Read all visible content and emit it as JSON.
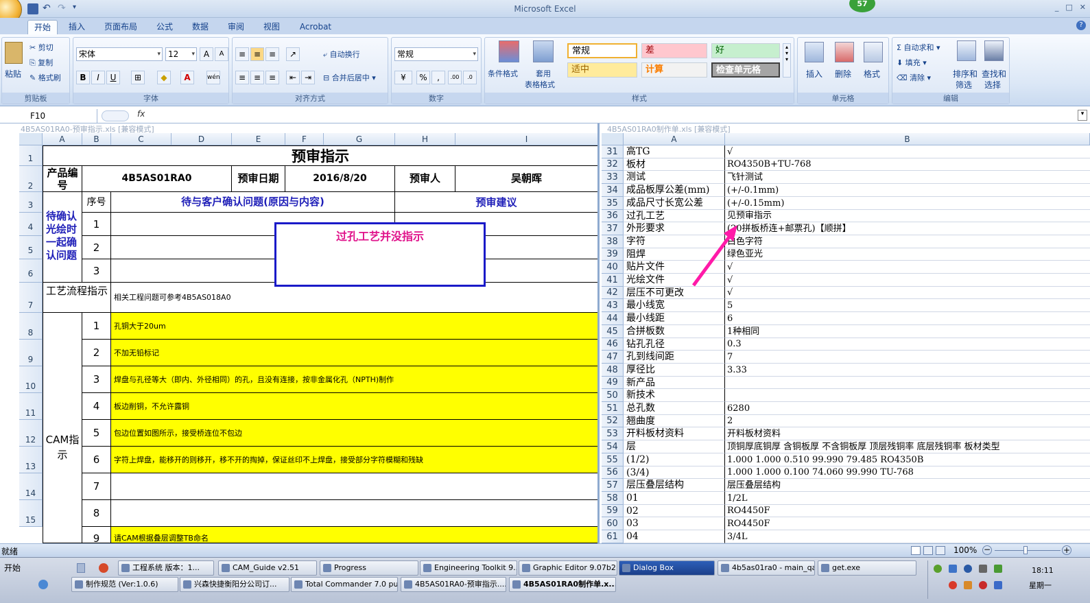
{
  "window": {
    "title": "Microsoft Excel",
    "badge": "57",
    "min": "_",
    "max": "□",
    "close": "✕"
  },
  "tabs": [
    "开始",
    "插入",
    "页面布局",
    "公式",
    "数据",
    "审阅",
    "视图",
    "Acrobat"
  ],
  "ribbon": {
    "clipboard": {
      "paste": "粘贴",
      "cut": "剪切",
      "copy": "复制",
      "format_painter": "格式刷",
      "label": "剪贴板"
    },
    "font": {
      "name": "宋体",
      "size": "12",
      "bold": "B",
      "italic": "I",
      "underline": "U",
      "label": "字体"
    },
    "alignment": {
      "wrap": "自动换行",
      "merge": "合并后居中",
      "label": "对齐方式"
    },
    "number": {
      "format": "常规",
      "percent": "%",
      "comma": ",",
      "label": "数字"
    },
    "styles": {
      "cond": "条件格式",
      "table1": "套用",
      "table2": "表格格式",
      "normal": "常规",
      "bad": "差",
      "good": "好",
      "neutral": "适中",
      "calc": "计算",
      "check": "检查单元格",
      "label": "样式"
    },
    "cells": {
      "insert": "插入",
      "delete": "删除",
      "format": "格式",
      "label": "单元格"
    },
    "editing": {
      "autosum": "自动求和",
      "fill": "填充",
      "clear": "清除",
      "sort1": "排序和",
      "sort2": "筛选",
      "find1": "查找和",
      "find2": "选择",
      "label": "编辑"
    }
  },
  "formula": {
    "namebox": "F10",
    "fx": "fx",
    "content": ""
  },
  "left_sheet": {
    "window_title": "4B5AS01RA0-预审指示.xls [兼容模式]",
    "col_headers": [
      "A",
      "B",
      "C",
      "D",
      "E",
      "F",
      "G",
      "H",
      "I"
    ],
    "rows": [
      "1",
      "2",
      "3",
      "4",
      "5",
      "6",
      "7",
      "8",
      "9",
      "10",
      "11",
      "12",
      "13",
      "14",
      "15"
    ],
    "title": "预审指示",
    "product_label": "产品编号",
    "product_no": "4B5AS01RA0",
    "review_date_label": "预审日期",
    "review_date": "2016/8/20",
    "reviewer_label": "预审人",
    "reviewer": "吴朝晖",
    "seq_label": "序号",
    "issues_header": "待与客户确认问题(原因与内容)",
    "suggest_header": "预审建议",
    "confirm_label": "待确认光绘时一起确认问题",
    "issue_nums": [
      "1",
      "2",
      "3"
    ],
    "note_box": "过孔工艺并没指示",
    "process_label": "工艺流程指示",
    "process_text": "相关工程问题可参考4B5AS018A0",
    "cam_label": "CAM指示",
    "cam_items": [
      {
        "n": "1",
        "t": "孔铜大于20um"
      },
      {
        "n": "2",
        "t": "不加无铅标记"
      },
      {
        "n": "3",
        "t": "焊盘与孔径等大（即内、外径相同）的孔，且没有连接，按非金属化孔（NPTH)制作"
      },
      {
        "n": "4",
        "t": "板边削铜，不允许露铜"
      },
      {
        "n": "5",
        "t": "包边位置如图所示，接受桥连位不包边"
      },
      {
        "n": "6",
        "t": "字符上焊盘，能移开的则移开，移不开的掏掉，保证丝印不上焊盘，接受部分字符模糊和残缺"
      },
      {
        "n": "7",
        "t": ""
      },
      {
        "n": "8",
        "t": ""
      },
      {
        "n": "9",
        "t": "请CAM根据叠层调整TB命名"
      }
    ]
  },
  "right_sheet": {
    "window_title": "4B5AS01RA0制作单.xls [兼容模式]",
    "col_a": "A",
    "col_b": "B",
    "rows": [
      {
        "r": "31",
        "a": "高TG",
        "b": "√"
      },
      {
        "r": "32",
        "a": "板材",
        "b": "RO4350B+TU-768"
      },
      {
        "r": "33",
        "a": "测试",
        "b": "飞针测试"
      },
      {
        "r": "34",
        "a": "成品板厚公差(mm)",
        "b": "(+/-0.1mm)"
      },
      {
        "r": "35",
        "a": "成品尺寸长宽公差",
        "b": "(+/-0.15mm)"
      },
      {
        "r": "36",
        "a": "过孔工艺",
        "b": "见预审指示"
      },
      {
        "r": "37",
        "a": "外形要求",
        "b": "(20拼板桥连+邮票孔)【顺拼】"
      },
      {
        "r": "38",
        "a": "字符",
        "b": "白色字符"
      },
      {
        "r": "39",
        "a": "阻焊",
        "b": "绿色亚光"
      },
      {
        "r": "40",
        "a": "贴片文件",
        "b": "√"
      },
      {
        "r": "41",
        "a": "光绘文件",
        "b": "√"
      },
      {
        "r": "42",
        "a": "层压不可更改",
        "b": "√"
      },
      {
        "r": "43",
        "a": "最小线宽",
        "b": "5"
      },
      {
        "r": "44",
        "a": "最小线距",
        "b": "6"
      },
      {
        "r": "45",
        "a": "合拼板数",
        "b": "1种相同"
      },
      {
        "r": "46",
        "a": "钻孔孔径",
        "b": "0.3"
      },
      {
        "r": "47",
        "a": "孔到线间距",
        "b": "7"
      },
      {
        "r": "48",
        "a": "厚径比",
        "b": "3.33"
      },
      {
        "r": "49",
        "a": "新产品",
        "b": ""
      },
      {
        "r": "50",
        "a": "新技术",
        "b": ""
      },
      {
        "r": "51",
        "a": "总孔数",
        "b": "6280"
      },
      {
        "r": "52",
        "a": "翘曲度",
        "b": "2"
      },
      {
        "r": "53",
        "a": "开料板材资料",
        "b": "开料板材资料"
      },
      {
        "r": "54",
        "a": "层",
        "b": "顶铜厚底铜厚 含铜板厚 不含铜板厚 顶层残铜率 底层残铜率 板材类型"
      },
      {
        "r": "55",
        "a": "(1/2)",
        "b": "1.000  1.000          0.510      99.990   79.485       RO4350B"
      },
      {
        "r": "56",
        "a": "(3/4)",
        "b": "1.000  1.000          0.100      74.060   99.990       TU-768"
      },
      {
        "r": "57",
        "a": "层压叠层结构",
        "b": "层压叠层结构"
      },
      {
        "r": "58",
        "a": "01",
        "b": "1/2L"
      },
      {
        "r": "59",
        "a": "02",
        "b": "RO4450F"
      },
      {
        "r": "60",
        "a": "03",
        "b": "RO4450F"
      },
      {
        "r": "61",
        "a": "04",
        "b": "3/4L"
      }
    ]
  },
  "status": {
    "ready": "就绪",
    "zoom": "100%"
  },
  "taskbar": {
    "start": "开始",
    "row1": [
      "工程系统  版本：1...",
      "CAM_Guide v2.51",
      "Progress",
      "Engineering Toolkit 9....",
      "Graphic Editor 9.07b2 ...",
      "Dialog Box",
      "4b5as01ra0 - main_qa",
      "get.exe"
    ],
    "row2": [
      "制作规范 (Ver:1.0.6)",
      "兴森快捷衡阳分公司订...",
      "Total Commander 7.0 pu...",
      "4B5AS01RA0-预审指示....",
      "4B5AS01RA0制作单.x..."
    ],
    "time": "18:11",
    "day": "星期一"
  },
  "colors": {
    "accent": "#15428b",
    "yellow": "#ffff00",
    "magenta": "#ff1aa8",
    "blue_text": "#1f1fb8"
  }
}
